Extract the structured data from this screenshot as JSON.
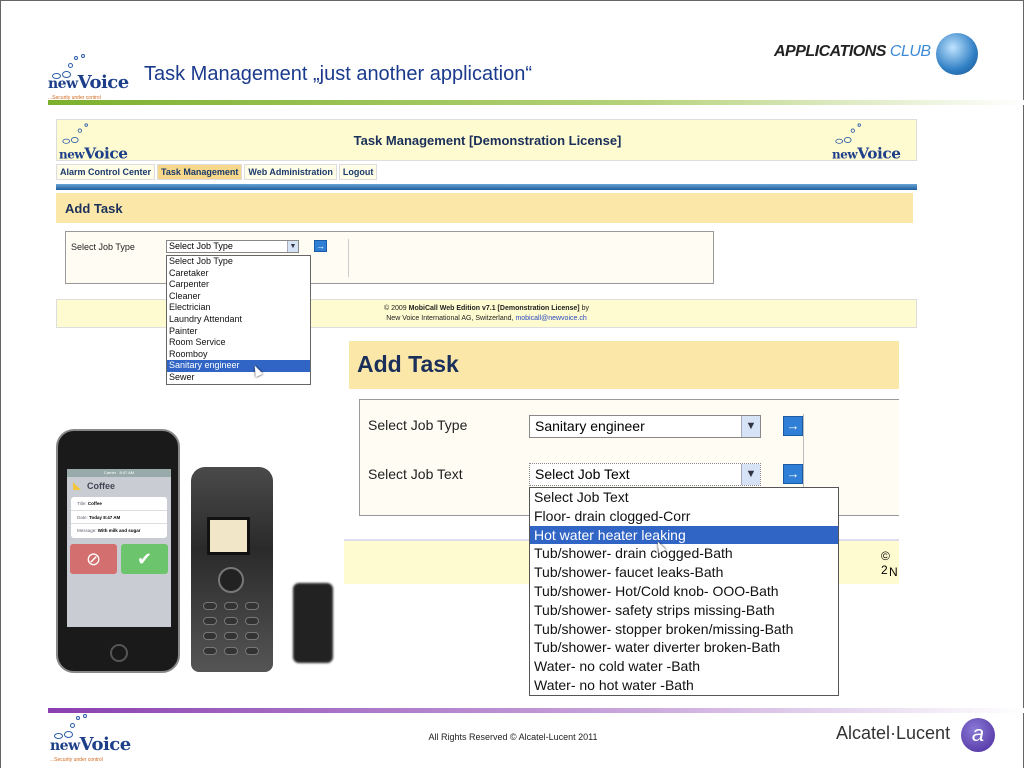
{
  "slide": {
    "title": "Task Management „just another application“",
    "apps_club": {
      "main": "APPLICATIONS",
      "accent": "CLUB"
    },
    "copyright": "All Rights Reserved © Alcatel-Lucent 2011",
    "vendor": "Alcatel·Lucent"
  },
  "logo": {
    "brand_prefix": "new",
    "brand_main": "Voice",
    "tagline": "...Security under control"
  },
  "app": {
    "title": "Task Management [Demonstration License]",
    "nav": [
      "Alarm Control Center",
      "Task Management",
      "Web Administration",
      "Logout"
    ],
    "section": "Add Task",
    "job_type_label": "Select Job Type",
    "job_type_value": "Select Job Type",
    "go": "→",
    "footer_line1_pre": "© 2009 ",
    "footer_line1_bold": "MobiCall Web Edition v7.1 [Demonstration License]",
    "footer_line1_post": " by",
    "footer_line2_pre": "New Voice International AG, Switzerland, ",
    "footer_email": "mobicall@newvoice.ch",
    "job_types": [
      "Select Job Type",
      "Caretaker",
      "Carpenter",
      "Cleaner",
      "Electrician",
      "Laundry Attendant",
      "Painter",
      "Room Service",
      "Roomboy",
      "Sanitary engineer",
      "Sewer"
    ],
    "job_type_highlighted": 9
  },
  "zoom": {
    "section": "Add Task",
    "job_type_label": "Select Job Type",
    "job_type_value": "Sanitary engineer",
    "job_text_label": "Select Job Text",
    "job_text_value": "Select Job Text",
    "footer_fragment1": "© 2",
    "footer_fragment2": "N",
    "job_texts": [
      "Select Job Text",
      "Floor- drain clogged-Corr",
      "Hot water heater leaking",
      "Tub/shower- drain clogged-Bath",
      "Tub/shower- faucet leaks-Bath",
      "Tub/shower- Hot/Cold knob- OOO-Bath",
      "Tub/shower- safety strips missing-Bath",
      "Tub/shower- stopper broken/missing-Bath",
      "Tub/shower- water diverter broken-Bath",
      "Water- no cold water -Bath",
      "Water- no hot water -Bath"
    ],
    "job_text_highlighted": 2
  },
  "iphone": {
    "carrier": "Carrier",
    "time": "8:47 AM",
    "header": "Coffee",
    "rows": [
      {
        "k": "Title:",
        "v": "Coffee"
      },
      {
        "k": "Date:",
        "v": "Today 8:47 AM"
      },
      {
        "k": "Message:",
        "v": "With milk and sugar"
      }
    ],
    "decline": "⊘",
    "accept": "✔"
  },
  "colors": {
    "accent_blue": "#1a3a8c",
    "highlight": "#3165c5",
    "band": "#fbe7a8"
  }
}
